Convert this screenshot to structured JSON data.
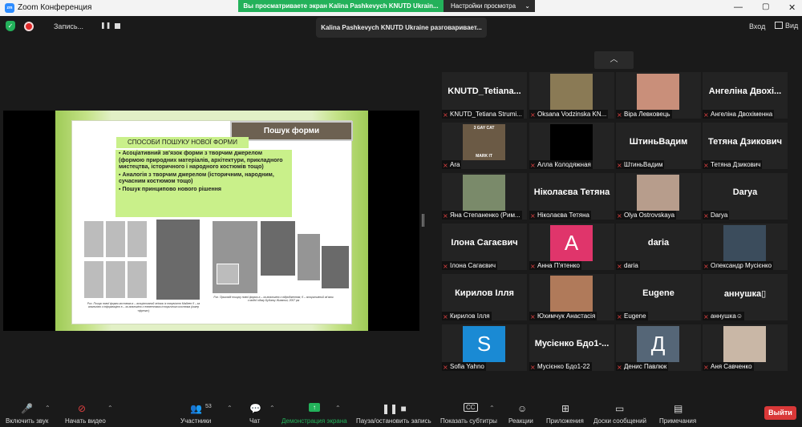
{
  "titlebar": {
    "app_title": "Zoom Конференция",
    "logo_text": "zm",
    "share_banner": "Вы просматриваете экран Kalina Pashkevych KNUTD Ukrain...",
    "view_options": "Настройки просмотра"
  },
  "topbar": {
    "recording_label": "Запись...",
    "speaker": "Kalina Pashkevych KNUTD Ukraine разговаривает...",
    "enter": "Вход",
    "view": "Вид"
  },
  "slide": {
    "tab": "Пошук форми",
    "heading": "СПОСОБИ ПОШУКУ НОВОЇ ФОРМИ",
    "items": [
      "Асоціативний зв'язок форми з творчим джерелом (формою природних матеріалів, архітектури, прикладного мистецтва, історичного і народного костюмів тощо)",
      "Аналогія з творчим джерелом (історичним, народним, сучасним костюмом тощо)",
      "Пошук принципово нового рішення"
    ],
    "caption_left": "Рис. Пошук нової форми костюма а – асоціативний зв'язок із творчістю Мадлен б – за аналогією з інформацією в – за аналогією з елементами історичного костюма (кокер «фреза»)",
    "caption_right": "Рис. Прикладі пошуку нової форми а – за аналогією з відродженням; б – асоціативний зв'язок з модої одягу Будинку Живанші, 2007 рік"
  },
  "participants": [
    {
      "display": "KNUTD_Tetiana...",
      "label": "KNUTD_Tetiana Strumi...",
      "media": "text"
    },
    {
      "display": "",
      "label": "Oksana Vodzinska KN...",
      "media": "photo",
      "color": "#8a7a55"
    },
    {
      "display": "",
      "label": "Віра Левковець",
      "media": "photo",
      "color": "#c98f7a"
    },
    {
      "display": "Ангеліна Двохі...",
      "label": "Ангеліна Двохіменна",
      "media": "text"
    },
    {
      "display": "",
      "label": "Ara",
      "media": "photo",
      "color": "#6b5a45",
      "caption": "3 GAY CAT",
      "caption2": "MARK IT"
    },
    {
      "display": "",
      "label": "Алла Колодяжная",
      "media": "black"
    },
    {
      "display": "ШтиньВадим",
      "label": "ШтиньВадим",
      "media": "text"
    },
    {
      "display": "Тетяна Дзикович",
      "label": "Тетяна Дзикович",
      "media": "text"
    },
    {
      "display": "",
      "label": "Яна Степаненко (Рим...",
      "media": "photo",
      "color": "#7a8a6a"
    },
    {
      "display": "Ніколаєва Тетяна",
      "label": "Ніколаєва Тетяна",
      "media": "text"
    },
    {
      "display": "",
      "label": "Olya Ostrovskaya",
      "media": "photo",
      "color": "#b79d8c"
    },
    {
      "display": "Darya",
      "label": "Darya",
      "media": "text"
    },
    {
      "display": "Ілона Сагаєвич",
      "label": "Ілона Сагаєвич",
      "media": "text"
    },
    {
      "display": "A",
      "label": "Анна П'ятенко",
      "media": "avatar",
      "color": "#e0356b"
    },
    {
      "display": "daria",
      "label": "daria",
      "media": "text"
    },
    {
      "display": "",
      "label": "Олександр Мусієнко",
      "media": "photo",
      "color": "#3b4c5c"
    },
    {
      "display": "Кирилов Ілля",
      "label": "Кирилов Ілля",
      "media": "text"
    },
    {
      "display": "",
      "label": "Юхимчук Анастасія",
      "media": "photo",
      "color": "#b07a5a"
    },
    {
      "display": "Eugene",
      "label": "Eugene",
      "media": "text"
    },
    {
      "display": "аннушка▯",
      "label": "аннушка☺",
      "media": "text"
    },
    {
      "display": "S",
      "label": "Sofia Yahno",
      "media": "avatar",
      "color": "#1a8ad4"
    },
    {
      "display": "Мусієнко Бдо1-...",
      "label": "Мусієнко Бдо1-22",
      "media": "text"
    },
    {
      "display": "Д",
      "label": "Денис Павлюк",
      "media": "avatar",
      "color": "#556677"
    },
    {
      "display": "",
      "label": "Аня Савченко",
      "media": "photo",
      "color": "#c9b7a6"
    }
  ],
  "toolbar": {
    "mic": "Включить звук",
    "video": "Начать видео",
    "participants": "Участники",
    "participants_count": "53",
    "chat": "Чат",
    "share": "Демонстрация экрана",
    "pause_rec": "Пауза/остановить запись",
    "captions": "Показать субтитры",
    "reactions": "Реакции",
    "apps": "Приложения",
    "whiteboards": "Доски сообщений",
    "notes": "Примечания",
    "exit": "Выйти"
  }
}
